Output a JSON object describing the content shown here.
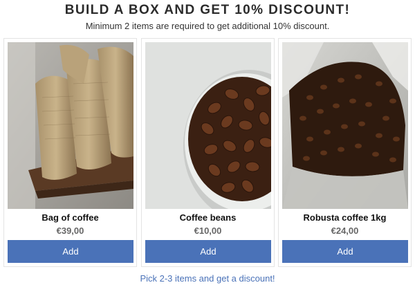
{
  "header": {
    "title": "BUILD A BOX AND GET 10% DISCOUNT!",
    "subtitle": "Minimum 2 items are required to get additional 10% discount."
  },
  "products": [
    {
      "name": "Bag of coffee",
      "price": "€39,00",
      "add_label": "Add",
      "image": "burlap-coffee-sacks-image"
    },
    {
      "name": "Coffee beans",
      "price": "€10,00",
      "add_label": "Add",
      "image": "coffee-beans-bowl-image"
    },
    {
      "name": "Robusta coffee 1kg",
      "price": "€24,00",
      "add_label": "Add",
      "image": "coffee-beans-bag-image"
    }
  ],
  "footer": {
    "hint": "Pick 2-3 items and get a discount!"
  },
  "colors": {
    "accent": "#4a72b8"
  }
}
